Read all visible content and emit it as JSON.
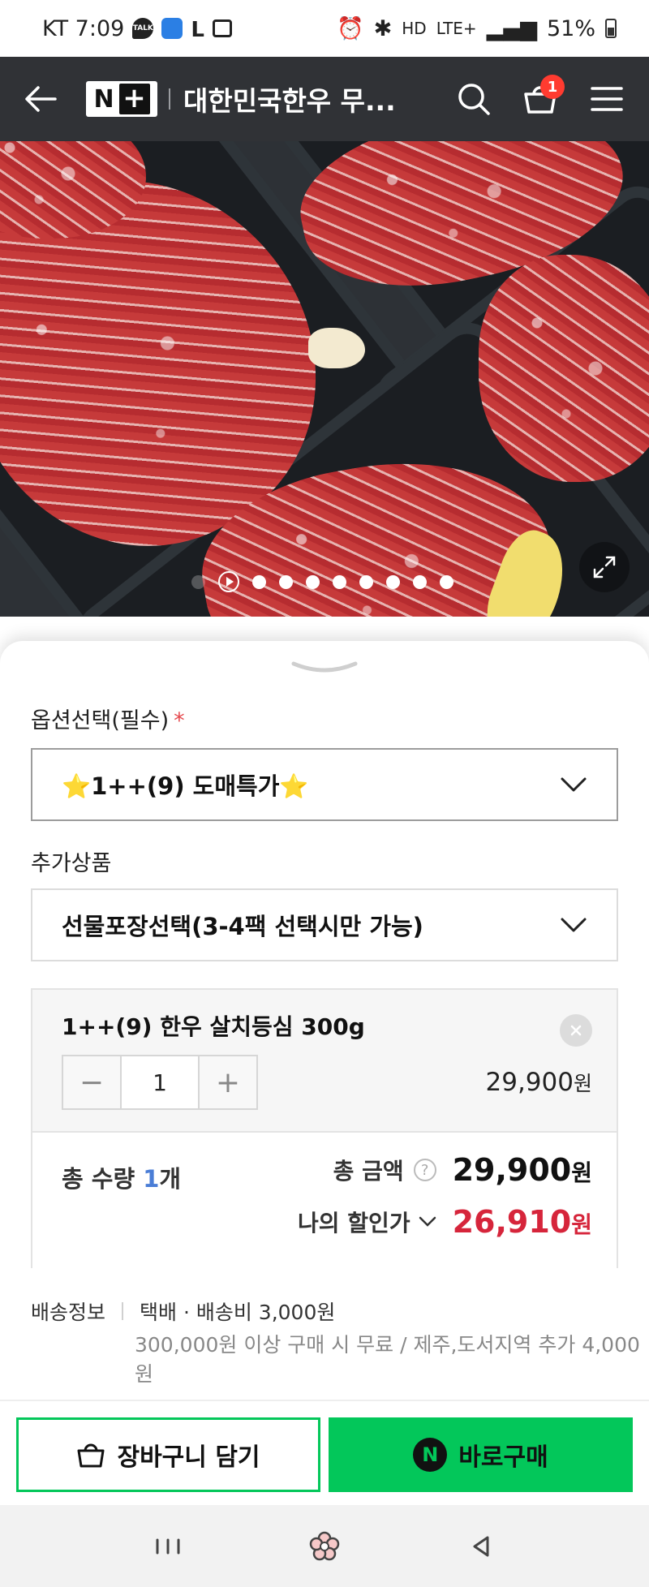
{
  "status_bar": {
    "carrier_time": "KT 7:09",
    "talk_label": "TALK",
    "lte": "LTE+",
    "battery": "51%"
  },
  "header": {
    "logo_text": "N",
    "logo_plus": "+",
    "store_title": "대한민국한우 무...",
    "cart_count": "1"
  },
  "hero": {
    "slide_count": 10,
    "current_slide": 1
  },
  "options": {
    "option_label": "옵션선택(필수)",
    "required_mark": "*",
    "option_value": "⭐1++(9) 도매특가⭐",
    "addon_label": "추가상품",
    "addon_value": "선물포장선택(3-4팩 선택시만 가능)"
  },
  "selected_item": {
    "name": "1++(9) 한우 살치등심 300g",
    "quantity": "1",
    "minus": "−",
    "plus": "+",
    "price": "29,900",
    "currency": "원"
  },
  "summary": {
    "qty_prefix": "총 수량 ",
    "qty_value": "1",
    "qty_suffix": "개",
    "amount_label": "총 금액",
    "help": "?",
    "amount_value": "29,900",
    "amount_currency": "원",
    "discount_label": "나의 할인가",
    "discount_value": "26,910",
    "discount_currency": "원"
  },
  "shipping": {
    "label": "배송정보",
    "info": "택배 · 배송비 3,000원",
    "sub": "300,000원 이상 구매 시 무료 / 제주,도서지역 추가 4,000원"
  },
  "actions": {
    "cart_button": "장바구니 담기",
    "buy_icon": "N",
    "buy_button": "바로구매"
  },
  "colors": {
    "naver_green": "#03c75a",
    "discount_red": "#d6253b",
    "header_bg": "#303236"
  }
}
